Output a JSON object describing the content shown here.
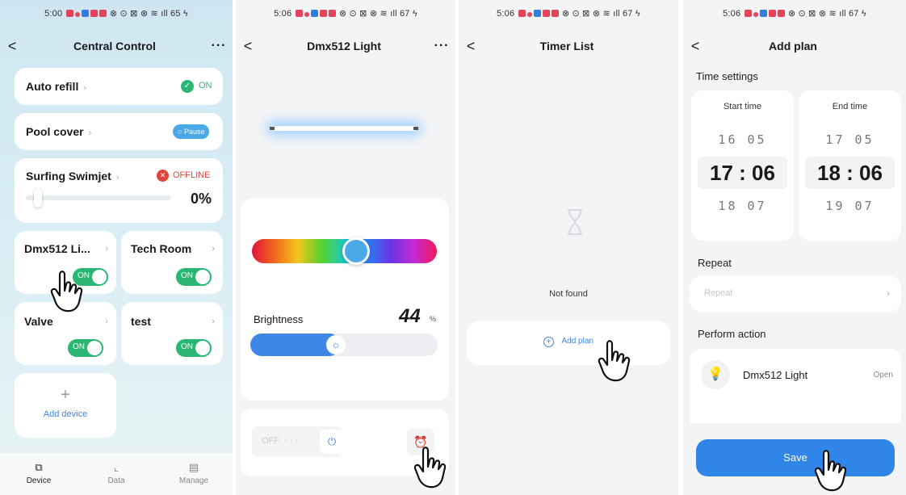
{
  "colors": {
    "accent": "#2f86e8",
    "toggle_on": "#2bb673",
    "offline": "#e0453a"
  },
  "panel1": {
    "status_time": "5:00",
    "status_icons": "⊗ ⊙ ⊠ ⊗ ≋ ıll 65 ϟ",
    "nav": {
      "back": "<",
      "title": "Central Control",
      "more": "···"
    },
    "auto_refill": {
      "label": "Auto refill",
      "status": "ON"
    },
    "pool_cover": {
      "label": "Pool cover",
      "status": "Pause"
    },
    "swimjet": {
      "label": "Surfing Swimjet",
      "status": "OFFLINE",
      "value": "0%",
      "level": 0
    },
    "tiles": [
      {
        "label": "Dmx512 Li...",
        "toggle": "ON"
      },
      {
        "label": "Tech Room",
        "toggle": "ON"
      },
      {
        "label": "Valve",
        "toggle": "ON"
      },
      {
        "label": "test",
        "toggle": "ON"
      }
    ],
    "add_device": {
      "icon": "+",
      "label": "Add device"
    },
    "tabs": [
      {
        "icon": "device-icon",
        "label": "Device"
      },
      {
        "icon": "chart-icon",
        "label": "Data"
      },
      {
        "icon": "doc-icon",
        "label": "Manage"
      }
    ]
  },
  "panel2": {
    "status_time": "5:06",
    "status_icons": "⊗ ⊙ ⊠ ⊗ ≋ ıll 67 ϟ",
    "nav": {
      "back": "<",
      "title": "Dmx512 Light",
      "more": "···"
    },
    "color_hue_fraction": 0.55,
    "brightness": {
      "label": "Brightness",
      "value": "44",
      "unit": "%",
      "level": 0.44
    },
    "power": {
      "off_label": "OFF",
      "power_icon": "power-icon",
      "timer_icon": "alarm-clock-icon"
    }
  },
  "panel3": {
    "status_time": "5:06",
    "status_icons": "⊗ ⊙ ⊠ ⊗ ≋ ıll 67 ϟ",
    "nav": {
      "back": "<",
      "title": "Timer List"
    },
    "empty_icon": "hourglass-icon",
    "empty_text": "Not found",
    "add_plan": {
      "icon": "+",
      "label": "Add plan"
    }
  },
  "panel4": {
    "status_time": "5:06",
    "status_icons": "⊗ ⊙ ⊠ ⊗ ≋ ıll 67 ϟ",
    "nav": {
      "back": "<",
      "title": "Add plan"
    },
    "time_settings": "Time settings",
    "start": {
      "header": "Start time",
      "prev": "16  05",
      "selected_h": "17",
      "selected_m": "06",
      "next": "18  07"
    },
    "end": {
      "header": "End time",
      "prev": "17  05",
      "selected_h": "18",
      "selected_m": "06",
      "next": "19  07"
    },
    "repeat_title": "Repeat",
    "repeat_placeholder": "Repeat",
    "perform_action": "Perform action",
    "action_device": "Dmx512 Light",
    "action_value": "Open",
    "save": "Save"
  }
}
